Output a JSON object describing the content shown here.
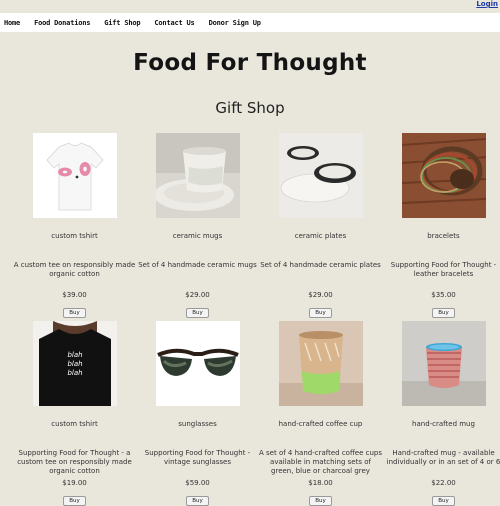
{
  "header": {
    "login_label": "Login"
  },
  "nav": {
    "items": [
      "Home",
      "Food Donations",
      "Gift Shop",
      "Contact Us",
      "Donor Sign Up"
    ]
  },
  "site_title": "Food For Thought",
  "section_title": "Gift Shop",
  "products": [
    {
      "name": "custom tshirt",
      "description": "A custom tee on responsibly made organic cotton",
      "price": "$39.00",
      "buy_label": "Buy",
      "image_icon": "white-tshirt-donut-image"
    },
    {
      "name": "ceramic mugs",
      "description": "Set of 4 handmade ceramic mugs",
      "price": "$29.00",
      "buy_label": "Buy",
      "image_icon": "ceramic-mug-image"
    },
    {
      "name": "ceramic plates",
      "description": "Set of 4 handmade ceramic plates",
      "price": "$29.00",
      "buy_label": "Buy",
      "image_icon": "ceramic-plates-image"
    },
    {
      "name": "bracelets",
      "description": "Supporting Food for Thought - leather bracelets",
      "price": "$35.00",
      "buy_label": "Buy",
      "image_icon": "leather-bracelets-image"
    },
    {
      "name": "custom tshirt",
      "description": "Supporting Food for Thought - a custom tee on responsibly made organic cotton",
      "price": "$19.00",
      "buy_label": "Buy",
      "image_icon": "black-tshirt-blah-image"
    },
    {
      "name": "sunglasses",
      "description": "Supporting Food for Thought - vintage sunglasses",
      "price": "$59.00",
      "buy_label": "Buy",
      "image_icon": "sunglasses-image"
    },
    {
      "name": "hand-crafted coffee cup",
      "description": "A set of 4 hand-crafted coffee cups available in matching sets of green, blue or charcoal grey",
      "price": "$18.00",
      "buy_label": "Buy",
      "image_icon": "coffee-cup-image"
    },
    {
      "name": "hand-crafted mug",
      "description": "Hand-crafted mug - available individually or in an set of 4 or 6",
      "price": "$22.00",
      "buy_label": "Buy",
      "image_icon": "striped-mug-image"
    }
  ],
  "tshirt_print_lines": [
    "blah",
    "blah",
    "blah"
  ]
}
